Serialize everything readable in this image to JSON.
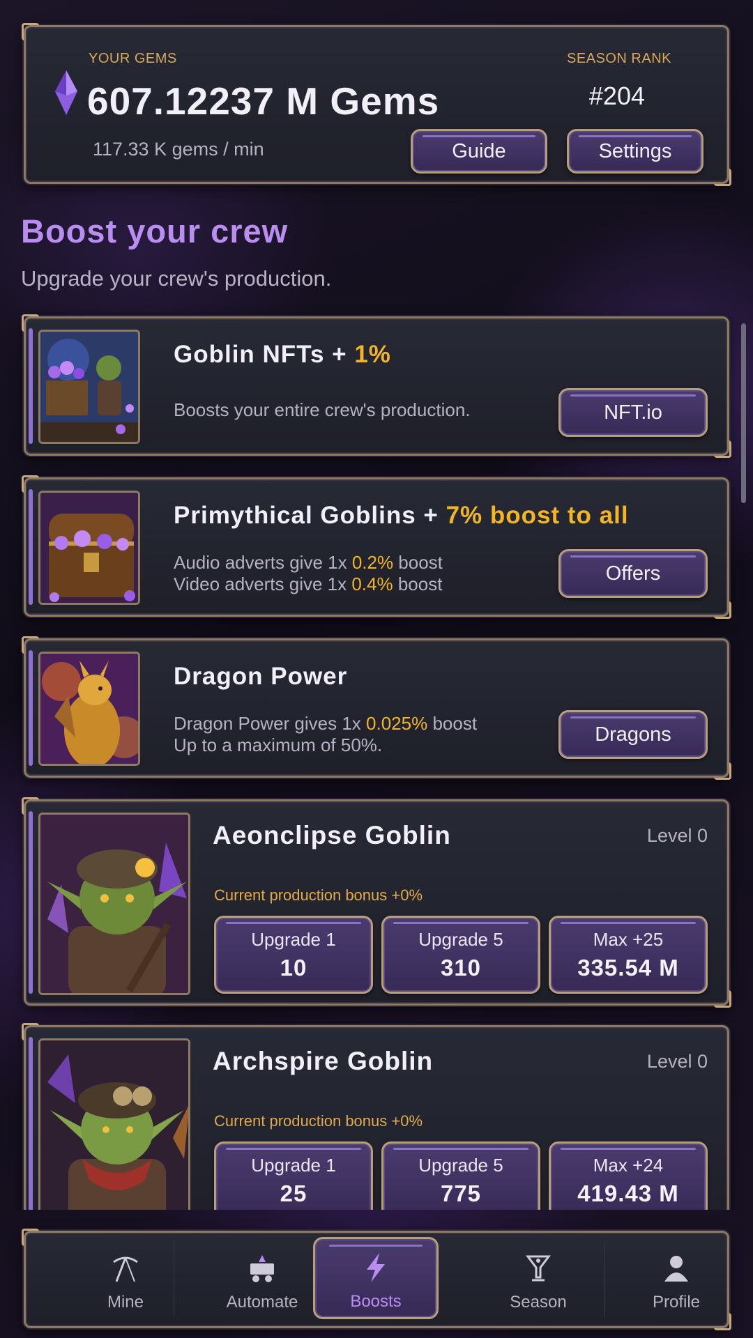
{
  "header": {
    "gems_label": "YOUR GEMS",
    "gems_amount": "607.12237 M Gems",
    "gems_rate": "117.33 K gems / min",
    "rank_label": "SEASON RANK",
    "rank_value": "#204",
    "guide_label": "Guide",
    "settings_label": "Settings"
  },
  "section": {
    "title": "Boost your crew",
    "subtitle": "Upgrade your crew's production."
  },
  "boosts": [
    {
      "title_main": "Goblin NFTs + ",
      "title_highlight": "1%",
      "desc": "Boosts your entire crew's production.",
      "button": "NFT.io"
    },
    {
      "title_main": "Primythical Goblins + ",
      "title_highlight": "7% boost to all",
      "line1_pre": "Audio adverts give 1x ",
      "line1_hl": "0.2%",
      "line1_post": " boost",
      "line2_pre": "Video adverts give 1x ",
      "line2_hl": "0.4%",
      "line2_post": " boost",
      "button": "Offers"
    },
    {
      "title_main": "Dragon Power",
      "line1_pre": "Dragon Power gives 1x ",
      "line1_hl": "0.025%",
      "line1_post": " boost",
      "line2": "Up to a maximum of 50%.",
      "button": "Dragons"
    }
  ],
  "goblins": [
    {
      "name": "Aeonclipse Goblin",
      "level": "Level 0",
      "bonus": "Current production bonus +0%",
      "upgrade1_label": "Upgrade 1",
      "upgrade1_value": "10",
      "upgrade5_label": "Upgrade 5",
      "upgrade5_value": "310",
      "max_label": "Max +25",
      "max_value": "335.54 M"
    },
    {
      "name": "Archspire Goblin",
      "level": "Level 0",
      "bonus": "Current production bonus +0%",
      "upgrade1_label": "Upgrade 1",
      "upgrade1_value": "25",
      "upgrade5_label": "Upgrade 5",
      "upgrade5_value": "775",
      "max_label": "Max +24",
      "max_value": "419.43 M"
    }
  ],
  "nav": {
    "mine": "Mine",
    "automate": "Automate",
    "boosts": "Boosts",
    "season": "Season",
    "profile": "Profile"
  },
  "colors": {
    "accent_purple": "#b98ef0",
    "highlight_gold": "#f2b526",
    "label_gold": "#d8a85a",
    "frame_bronze": "#8d7a64"
  },
  "icons": [
    "gem-icon",
    "pickaxe-icon",
    "minecart-icon",
    "lightning-icon",
    "trophy-icon",
    "person-icon"
  ]
}
